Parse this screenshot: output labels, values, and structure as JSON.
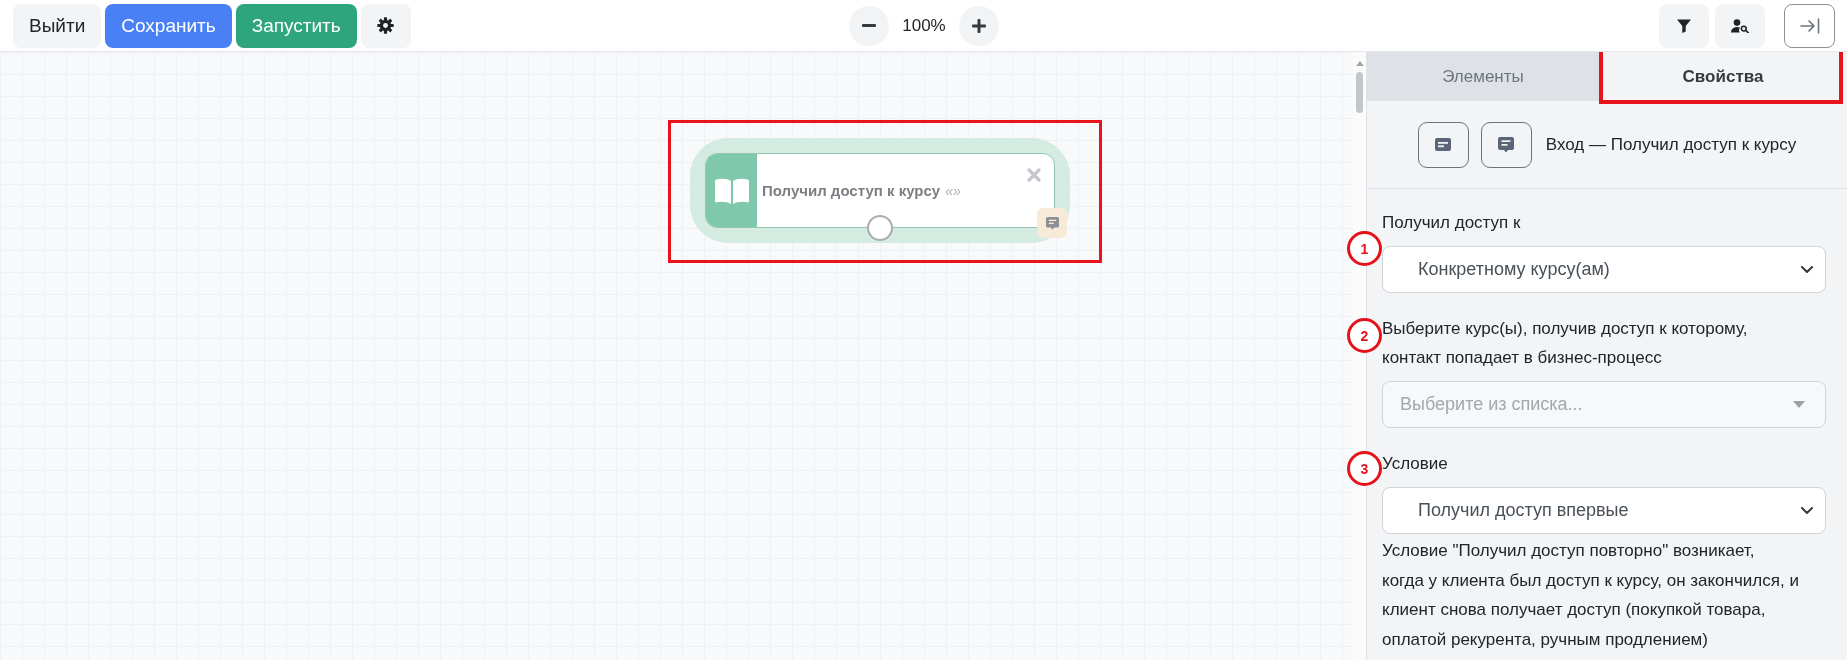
{
  "toolbar": {
    "actions": [
      {
        "label": "Выйти",
        "kind": "light"
      },
      {
        "label": "Сохранить",
        "kind": "primary"
      },
      {
        "label": "Запустить",
        "kind": "success"
      }
    ],
    "zoom": "100%"
  },
  "canvas": {
    "nodes": [
      {
        "title": "Получил доступ к курсу",
        "suffix": "«»",
        "highlighted": true
      }
    ]
  },
  "panel": {
    "tabs": [
      {
        "label": "Элементы",
        "selected": false,
        "highlighted": false
      },
      {
        "label": "Свойства",
        "selected": true,
        "highlighted": true
      }
    ],
    "heading": "Вход — Получил доступ к курсу",
    "fields": [
      {
        "marker": "1",
        "label": "Получил доступ к",
        "kind": "select",
        "value": "Конкретному курсу(ам)"
      },
      {
        "marker": "2",
        "label": "Выберите курс(ы), получив доступ к которому,\nконтакт попадает в бизнес-процесс",
        "kind": "combo",
        "placeholder": "Выберите из списка..."
      },
      {
        "marker": "3",
        "label": "Условие",
        "kind": "select",
        "value": "Получил доступ впервые",
        "help": "Условие \"Получил доступ повторно\" возникает,\nкогда у клиента был доступ к курсу, он закончился, и\nклиент снова получает доступ (покупкой товара,\nоплатой рекурента, ручным продлением)"
      }
    ]
  }
}
